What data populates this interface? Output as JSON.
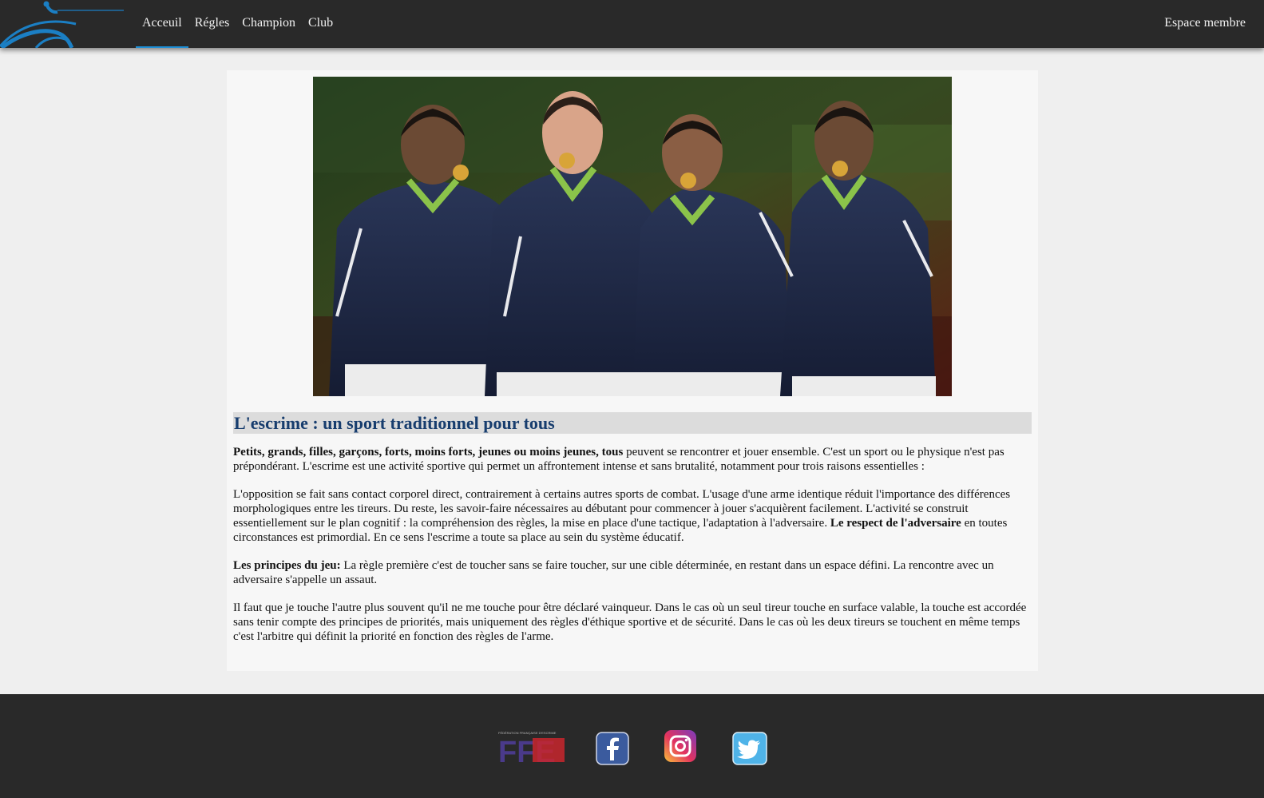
{
  "nav": {
    "items": [
      {
        "label": "Acceuil",
        "active": true
      },
      {
        "label": "Régles"
      },
      {
        "label": "Champion"
      },
      {
        "label": "Club"
      }
    ],
    "member_link": "Espace membre"
  },
  "article": {
    "title": "L'escrime : un sport traditionnel pour tous",
    "p1": {
      "bold": "Petits, grands, filles, garçons, forts, moins forts, jeunes ou moins jeunes, tous",
      "text": " peuvent se rencontrer et jouer ensemble. C'est un sport ou le physique n'est pas prépondérant. L'escrime est une activité sportive qui permet un affrontement intense et sans brutalité, notamment pour trois raisons essentielles :"
    },
    "p2": {
      "text": "L'opposition se fait sans contact corporel direct, contrairement à certains autres sports de combat. L'usage d'une arme identique réduit l'importance des différences morphologiques entre les tireurs. Du reste, les savoir-faire nécessaires au débutant pour commencer à jouer s'acquièrent facilement. L'activité se construit essentiellement sur le plan cognitif : la compréhension des règles, la mise en place d'une tactique, l'adaptation à l'adversaire. ",
      "bold": "Le respect de l'adversaire",
      "text2": " en toutes circonstances est primordial. En ce sens l'escrime a toute sa place au sein du système éducatif."
    },
    "p3": {
      "bold": "Les principes du jeu:",
      "text": " La règle première c'est de toucher sans se faire toucher, sur une cible déterminée, en restant dans un espace défini. La rencontre avec un adversaire s'appelle un assaut."
    },
    "p4": {
      "text": "Il faut que je touche l'autre plus souvent qu'il ne me touche pour être déclaré vainqueur. Dans le cas où un seul tireur touche en surface valable, la touche est accordée sans tenir compte des principes de priorités, mais uniquement des règles d'éthique sportive et de sécurité. Dans le cas où les deux tireurs se touchent en même temps c'est l'arbitre qui définit la priorité en fonction des règles de l'arme."
    }
  },
  "footer": {
    "ffe_small_text": "FÉDÉRATION FRANÇAISE D'ESCRIME",
    "ffe_logo_text": "FFE",
    "icons": [
      "ffe-logo",
      "facebook-icon",
      "instagram-icon",
      "twitter-icon"
    ]
  },
  "colors": {
    "nav_bg": "#292929",
    "accent": "#1e8fd6",
    "title": "#173d6e",
    "title_bg": "#dcdcdc",
    "page_bg": "#efefef",
    "content_bg": "#f7f7f7"
  }
}
